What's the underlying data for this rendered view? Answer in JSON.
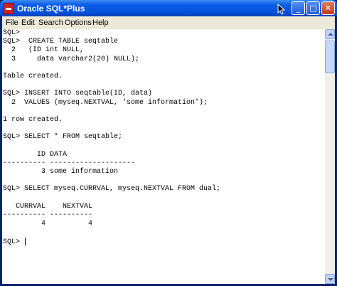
{
  "window": {
    "title": "Oracle SQL*Plus",
    "controls": {
      "minimize": "_",
      "maximize": "□",
      "close": "✕"
    }
  },
  "menu": {
    "items": [
      "File",
      "Edit",
      "Search",
      "Options",
      "Help"
    ]
  },
  "terminal": {
    "lines": [
      "SQL>",
      "SQL>  CREATE TABLE seqtable",
      "  2   (ID int NULL,",
      "  3     data varchar2(20) NULL);",
      "",
      "Table created.",
      "",
      "SQL> INSERT INTO seqtable(ID, data)",
      "  2  VALUES (myseq.NEXTVAL, 'some information');",
      "",
      "1 row created.",
      "",
      "SQL> SELECT * FROM seqtable;",
      "",
      "        ID DATA",
      "---------- --------------------",
      "         3 some information",
      "",
      "SQL> SELECT myseq.CURRVAL, myseq.NEXTVAL FROM dual;",
      "",
      "   CURRVAL    NEXTVAL",
      "---------- ----------",
      "         4          4",
      "",
      "SQL> "
    ]
  },
  "icons": {
    "app": "sqlplus-app-icon",
    "cursor": "mouse-pointer-icon"
  }
}
